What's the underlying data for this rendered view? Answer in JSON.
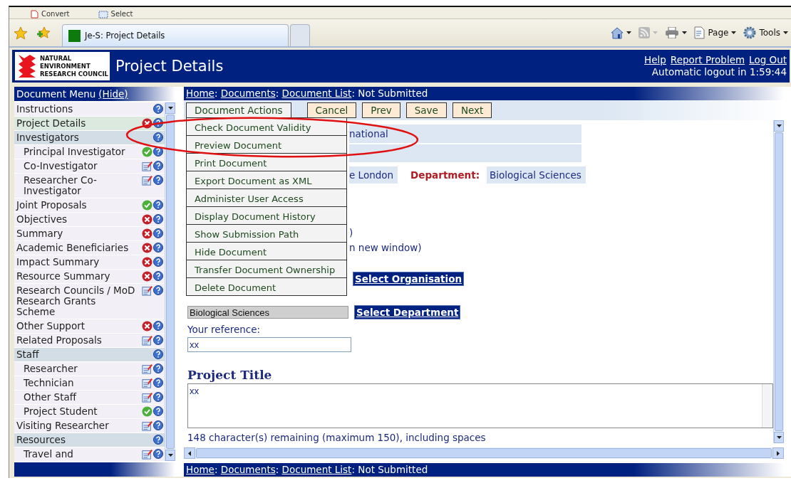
{
  "favorites_bar": {
    "items": [
      {
        "kind": "convert",
        "label": "Convert"
      },
      {
        "kind": "select",
        "label": "Select"
      }
    ]
  },
  "browser": {
    "tabs": [
      {
        "label": "Je-S: Project Details",
        "selected": true
      },
      {
        "selected": false
      }
    ],
    "commands": [
      {
        "kind": "home",
        "disabled": false
      },
      {
        "kind": "feeds",
        "disabled": true
      },
      {
        "kind": "print",
        "disabled": false
      },
      {
        "kind": "page",
        "label": "Page",
        "disabled": false
      },
      {
        "kind": "tools",
        "label": "Tools",
        "disabled": false
      }
    ]
  },
  "header": {
    "logo_lines": [
      "NATURAL",
      "ENVIRONMENT",
      "RESEARCH COUNCIL"
    ],
    "title": "Project Details",
    "links": [
      "Help",
      "Report Problem",
      "Log Out"
    ],
    "logout_notice": "Automatic logout in 1:59:44"
  },
  "sidebar": {
    "title": "Document Menu",
    "hide_link": "(Hide)",
    "items": [
      {
        "label": "Instructions",
        "kind": "plain",
        "selected": false
      },
      {
        "label": "Project Details",
        "kind": "error",
        "selected": true
      },
      {
        "label": "Investigators",
        "kind": "plain",
        "selected": false,
        "children": [
          {
            "label": "Principal Investigator",
            "kind": "complete",
            "selected": false
          },
          {
            "label": "Co-Investigator",
            "kind": "editable",
            "selected": false
          },
          {
            "label": "Researcher Co-Investigator",
            "kind": "editable",
            "selected": false
          }
        ]
      },
      {
        "label": "Joint Proposals",
        "kind": "complete",
        "selected": false
      },
      {
        "label": "Objectives",
        "kind": "error",
        "selected": false
      },
      {
        "label": "Summary",
        "kind": "error",
        "selected": false
      },
      {
        "label": "Academic Beneficiaries",
        "kind": "error",
        "selected": false
      },
      {
        "label": "Impact Summary",
        "kind": "error",
        "selected": false
      },
      {
        "label": "Resource Summary",
        "kind": "error",
        "selected": false
      },
      {
        "label": "Research Councils / MoD Research Grants Scheme",
        "kind": "editable",
        "selected": false
      },
      {
        "label": "Other Support",
        "kind": "error",
        "selected": false
      },
      {
        "label": "Related Proposals",
        "kind": "editable",
        "selected": false
      },
      {
        "label": "Staff",
        "kind": "plain",
        "selected": false,
        "children": [
          {
            "label": "Researcher",
            "kind": "editable",
            "selected": false
          },
          {
            "label": "Technician",
            "kind": "editable",
            "selected": false
          },
          {
            "label": "Other Staff",
            "kind": "editable",
            "selected": false
          },
          {
            "label": "Project Student",
            "kind": "complete",
            "selected": false
          }
        ]
      },
      {
        "label": "Visiting Researcher",
        "kind": "editable",
        "selected": false
      },
      {
        "label": "Resources",
        "kind": "plain",
        "selected": false,
        "children": [
          {
            "label": "Travel and",
            "kind": "editable",
            "selected": false
          }
        ]
      }
    ]
  },
  "breadcrumb_top": {
    "links": [
      "Home",
      "Documents",
      "Document List"
    ],
    "separator": ":",
    "current": "Not Submitted"
  },
  "toolbar": {
    "actions_menu": {
      "label": "Document Actions",
      "expanded": true,
      "items": [
        "Check Document Validity",
        "Preview Document",
        "Print Document",
        "Export Document as XML",
        "Administer User Access",
        "Display Document History",
        "Show Submission Path",
        "Hide Document",
        "Transfer Document Ownership",
        "Delete Document"
      ]
    },
    "buttons": [
      "Cancel",
      "Prev",
      "Save",
      "Next"
    ]
  },
  "form": {
    "row_1_value": "national",
    "row_3_value": "e London",
    "department_label": "Department:",
    "department_value": "Biological Sciences",
    "fragment_1": ")",
    "fragment_2": "n new window)",
    "organisation_button": "Select Organisation",
    "department_select": "Biological Sciences",
    "department_button": "Select Department",
    "reference_label": "Your reference:",
    "reference_value": "xx",
    "project_title_heading": "Project Title",
    "project_title_value": "xx",
    "remaining_note": "148 character(s) remaining (maximum 150), including spaces"
  },
  "breadcrumb_bottom": {
    "links": [
      "Home",
      "Documents",
      "Document List"
    ],
    "separator": ":",
    "current": "Not Submitted"
  }
}
